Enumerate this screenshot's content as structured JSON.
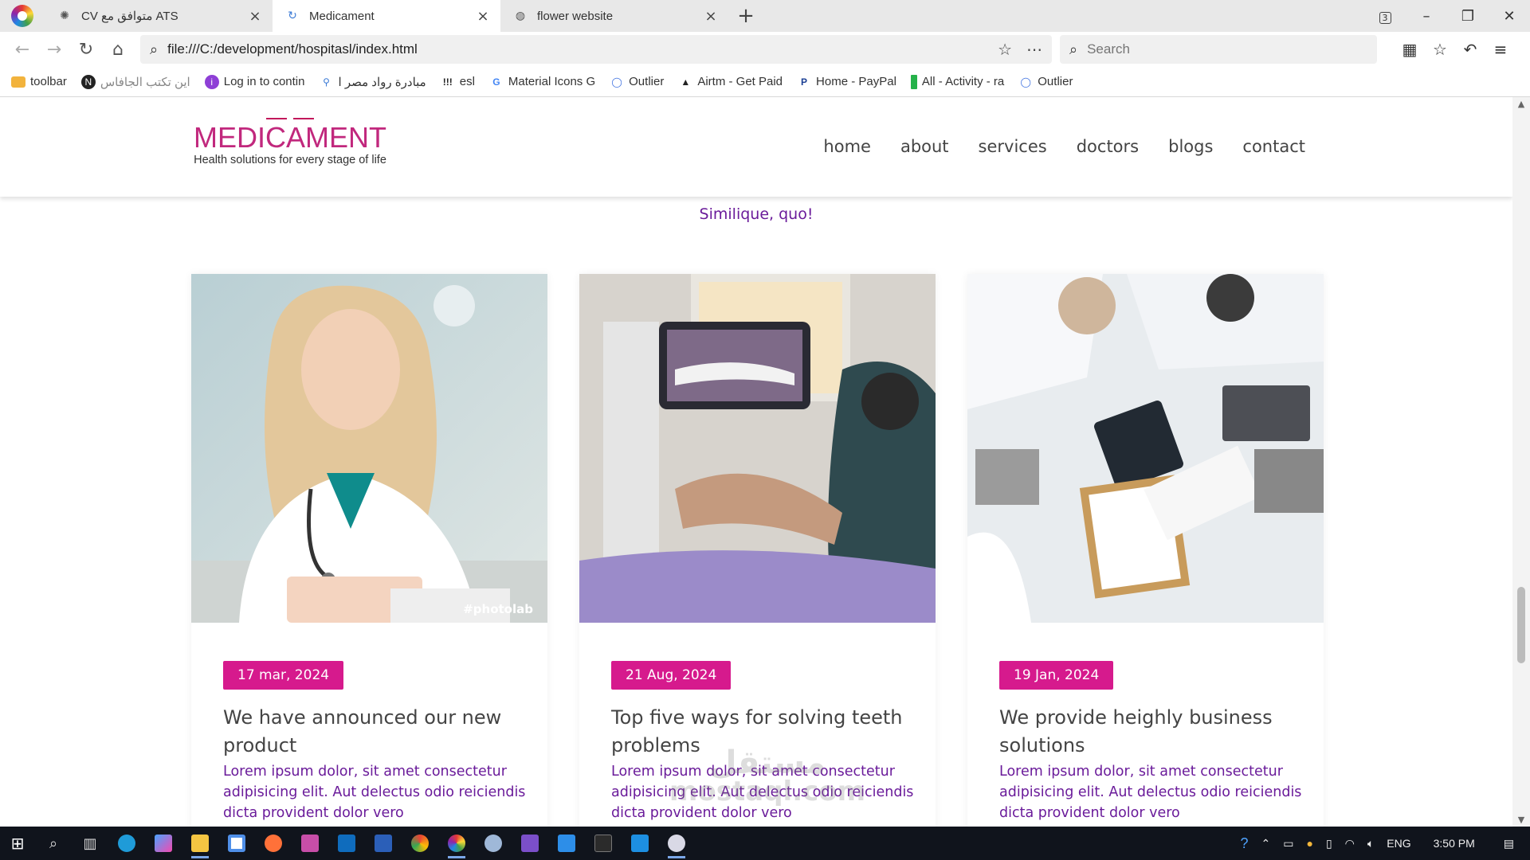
{
  "browser": {
    "tabs": [
      {
        "title": "CV متوافق مع ATS",
        "icon": "openai-icon",
        "active": false
      },
      {
        "title": "Medicament",
        "icon": "loading-icon",
        "active": true
      },
      {
        "title": "flower website",
        "icon": "globe-icon",
        "active": false
      }
    ],
    "tab_count": "3",
    "url": "file:///C:/development/hospitasl/index.html",
    "search_placeholder": "Search",
    "bookmarks": [
      {
        "label": "toolbar",
        "icon": "folder-icon",
        "color": "#f2b33d"
      },
      {
        "label": "اين تكتب الجافاس",
        "icon": "notion-icon",
        "color": "#222222"
      },
      {
        "label": "Log in to contin",
        "icon": "info-icon",
        "color": "#8e3fd6"
      },
      {
        "label": "مبادرة رواد مصر ا",
        "icon": "person-icon",
        "color": "#3c7bd6"
      },
      {
        "label": "esl",
        "icon": "exclaim-icon",
        "color": "#222222"
      },
      {
        "label": "Material Icons G",
        "icon": "google-icon",
        "color": "#4285f4"
      },
      {
        "label": "Outlier",
        "icon": "outlier-icon",
        "color": "#3b6fe0"
      },
      {
        "label": "Airtm - Get Paid",
        "icon": "airtm-icon",
        "color": "#222222"
      },
      {
        "label": "Home - PayPal",
        "icon": "paypal-icon",
        "color": "#1b3f94"
      },
      {
        "label": "All - Activity - ra",
        "icon": "activity-icon",
        "color": "#25b24a"
      },
      {
        "label": "Outlier",
        "icon": "outlier-icon",
        "color": "#3b6fe0"
      }
    ]
  },
  "site": {
    "logo_title": "MEDICAMENT",
    "logo_tagline": "Health solutions for every stage of life",
    "nav": [
      "home",
      "about",
      "services",
      "doctors",
      "blogs",
      "contact"
    ],
    "intro_tail": "Similique, quo!",
    "accent_color": "#d61a8d",
    "text_color": "#6a1b9a",
    "cards": [
      {
        "image": "doctor-portrait-photo",
        "image_caption": "#photolab",
        "date": "17 mar, 2024",
        "title": "We have announced our new product",
        "text": "Lorem ipsum dolor, sit amet consectetur adipisicing elit. Aut delectus odio reiciendis dicta provident dolor vero"
      },
      {
        "image": "dental-procedure-photo",
        "image_caption": "",
        "date": "21 Aug, 2024",
        "title": "Top five ways for solving teeth problems",
        "text": "Lorem ipsum dolor, sit amet consectetur adipisicing elit. Aut delectus odio reiciendis dicta provident dolor vero"
      },
      {
        "image": "doctors-meeting-photo",
        "image_caption": "",
        "date": "19 Jan, 2024",
        "title": "We provide heighly business solutions",
        "text": "Lorem ipsum dolor, sit amet consectetur adipisicing elit. Aut delectus odio reiciendis dicta provident dolor vero"
      }
    ]
  },
  "watermark": {
    "line1": "مستقل",
    "line2": "mostaql.com"
  },
  "taskbar": {
    "apps": [
      "start-icon",
      "search-icon",
      "task-view-icon",
      "edge-icon",
      "copilot-icon",
      "file-explorer-icon",
      "store-icon",
      "firefox-icon",
      "acrobat-icon",
      "outlook-icon",
      "word-icon",
      "chrome-icon",
      "browser-icon",
      "paint-icon",
      "visual-studio-icon",
      "azure-icon",
      "terminal-icon",
      "vscode-icon",
      "browser-alt-icon"
    ],
    "language": "ENG",
    "time": "3:50 PM"
  }
}
